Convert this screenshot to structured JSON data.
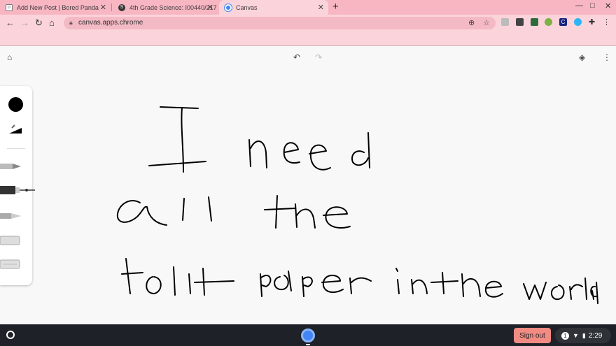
{
  "tabs": [
    {
      "title": "Add New Post | Bored Panda",
      "favicon": "bored-panda-icon"
    },
    {
      "title": "4th Grade Science: I00440/217",
      "favicon": "schoology-icon"
    },
    {
      "title": "Canvas",
      "favicon": "canvas-icon",
      "active": true
    }
  ],
  "address_bar": {
    "url": "canvas.apps.chrome"
  },
  "extensions": [
    "calendar-ext-icon",
    "calculator-ext-icon",
    "notes-ext-icon",
    "leaf-ext-icon",
    "c-ext-icon",
    "globe-ext-icon",
    "puzzle-icon"
  ],
  "canvas_app": {
    "handwritten_text": [
      "I need",
      "all the",
      "tolit paper in the world"
    ],
    "palette_color": "#000000"
  },
  "taskbar": {
    "sign_out_label": "Sign out",
    "notification_count": "1",
    "time": "2:29"
  },
  "colors": {
    "browser_frame": "#f7b6c2",
    "toolbar": "#fbd3db",
    "signout": "#f28b82",
    "shelf": "#1e2127"
  }
}
